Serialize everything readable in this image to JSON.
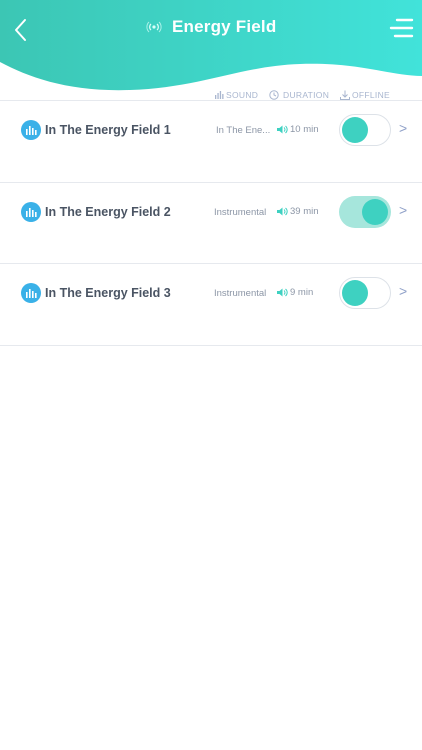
{
  "header": {
    "title": "Energy Field",
    "colors": {
      "gradient_start": "#3cc6b4",
      "gradient_end": "#41e3da"
    },
    "back_icon": "chevron-left-icon",
    "title_icon": "signal-waves-icon",
    "menu_icon": "hamburger-menu-icon"
  },
  "columns": {
    "sound": "SOUND",
    "duration": "DURATION",
    "offline": "OFFLINE"
  },
  "tracks": [
    {
      "title": "In The Energy Field 1",
      "sound": "In The Ene...",
      "duration": "10 min",
      "offline": false,
      "arrow": ">"
    },
    {
      "title": "In The Energy Field 2",
      "sound": "Instrumental",
      "duration": "39 min",
      "offline": true,
      "arrow": ">"
    },
    {
      "title": "In The Energy Field 3",
      "sound": "Instrumental",
      "duration": "9 min",
      "offline": false,
      "arrow": ">"
    }
  ],
  "colors": {
    "accent": "#3ed1c1",
    "track_icon": "#3ab1e8",
    "divider": "#e6e9ee",
    "chevron": "#8fa0c8"
  }
}
